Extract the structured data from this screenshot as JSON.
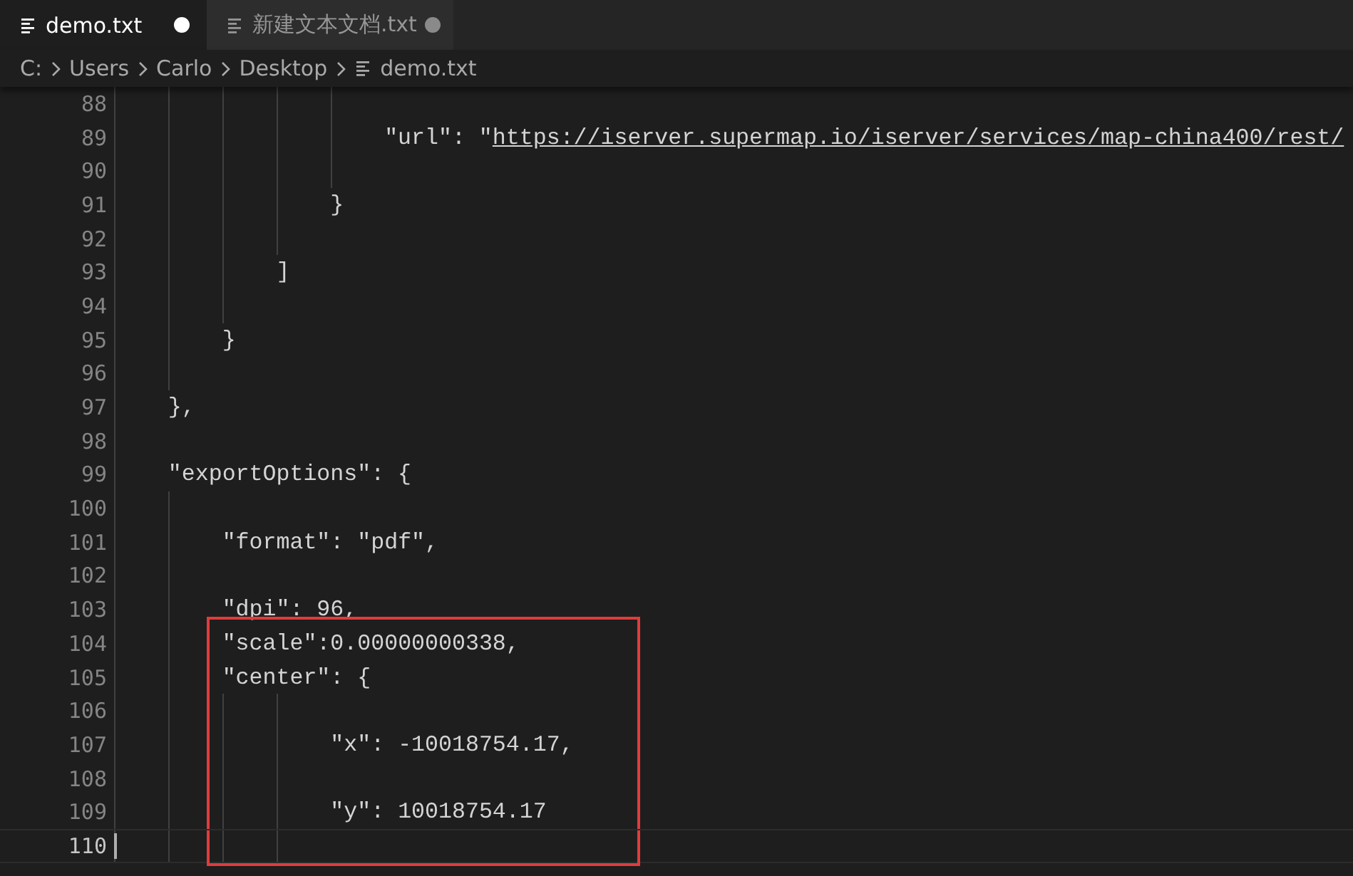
{
  "tabs": [
    {
      "label": "demo.txt",
      "selected": true,
      "modified": true
    },
    {
      "label": "新建文本文档.txt",
      "selected": false,
      "modified": true
    }
  ],
  "breadcrumbs": [
    {
      "label": "C:",
      "kind": "folder"
    },
    {
      "label": "Users",
      "kind": "folder"
    },
    {
      "label": "Carlo",
      "kind": "folder"
    },
    {
      "label": "Desktop",
      "kind": "folder"
    },
    {
      "label": "demo.txt",
      "kind": "file"
    }
  ],
  "editor": {
    "lines": [
      {
        "number": "88",
        "current": false,
        "highlighted": false
      },
      {
        "number": "89",
        "text": "                    \"url\": \"",
        "link": "https://iserver.supermap.io/iserver/services/map-china400/rest/",
        "current": false,
        "highlighted": false
      },
      {
        "number": "90",
        "current": false,
        "highlighted": false
      },
      {
        "number": "91",
        "text": "                }",
        "current": false,
        "highlighted": false
      },
      {
        "number": "92",
        "current": false,
        "highlighted": false
      },
      {
        "number": "93",
        "text": "            ]",
        "current": false,
        "highlighted": false
      },
      {
        "number": "94",
        "current": false,
        "highlighted": false
      },
      {
        "number": "95",
        "text": "        }",
        "current": false,
        "highlighted": false
      },
      {
        "number": "96",
        "current": false,
        "highlighted": false
      },
      {
        "number": "97",
        "text": "    },",
        "current": false,
        "highlighted": false
      },
      {
        "number": "98",
        "current": false,
        "highlighted": false
      },
      {
        "number": "99",
        "text": "    \"exportOptions\": {",
        "current": false,
        "highlighted": false
      },
      {
        "number": "100",
        "current": false,
        "highlighted": false
      },
      {
        "number": "101",
        "text": "        \"format\": \"pdf\",",
        "current": false,
        "highlighted": false
      },
      {
        "number": "102",
        "current": false,
        "highlighted": false
      },
      {
        "number": "103",
        "text": "        \"dpi\": 96,",
        "current": false,
        "highlighted": false
      },
      {
        "number": "104",
        "text": "        \"scale\":0.00000000338,",
        "current": false,
        "highlighted": true
      },
      {
        "number": "105",
        "text": "        \"center\": {",
        "current": false,
        "highlighted": true
      },
      {
        "number": "106",
        "current": false,
        "highlighted": true
      },
      {
        "number": "107",
        "text": "                \"x\": -10018754.17,",
        "current": false,
        "highlighted": true
      },
      {
        "number": "108",
        "current": false,
        "highlighted": true
      },
      {
        "number": "109",
        "text": "                \"y\": 10018754.17",
        "current": false,
        "highlighted": true
      },
      {
        "number": "110",
        "current": true,
        "highlighted": true
      }
    ]
  }
}
